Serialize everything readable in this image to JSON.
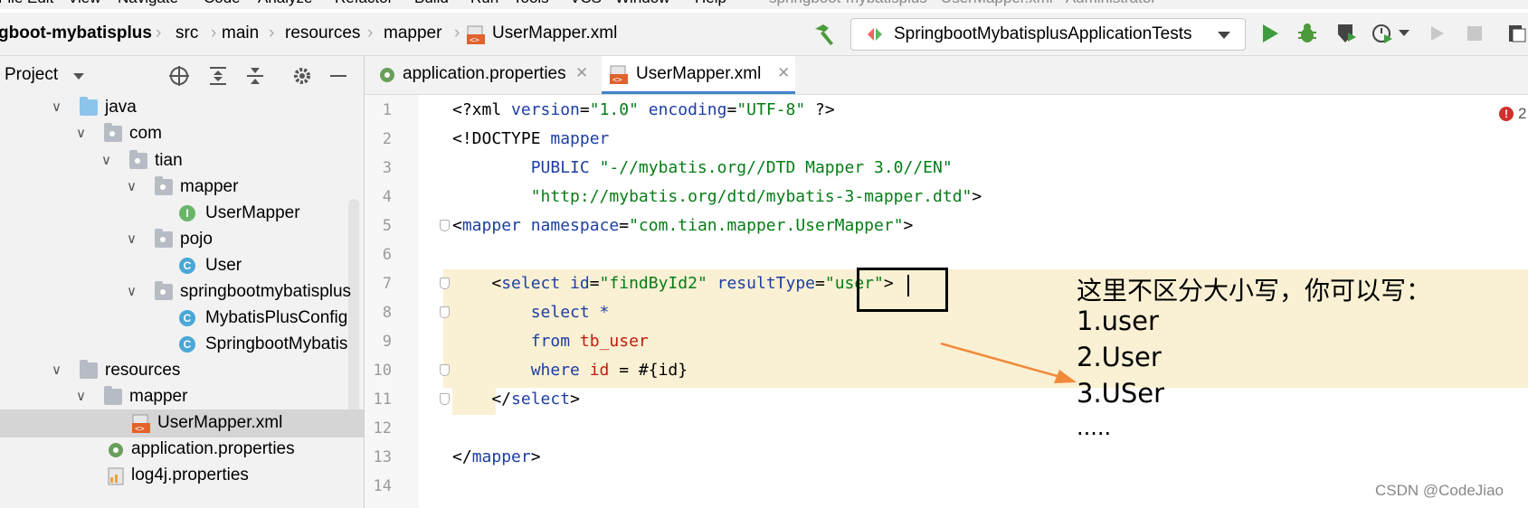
{
  "menubar": {
    "items": [
      "File",
      "Edit",
      "View",
      "Navigate",
      "Code",
      "Analyze",
      "Refactor",
      "Build",
      "Run",
      "Tools",
      "VCS",
      "Window",
      "Help"
    ],
    "window_title": "springboot-mybatisplus - UserMapper.xml - Administrator"
  },
  "breadcrumb": [
    "gboot-mybatisplus",
    "src",
    "main",
    "resources",
    "mapper",
    "UserMapper.xml"
  ],
  "run_config": {
    "label": "SpringbootMybatisplusApplicationTests"
  },
  "project_panel": {
    "title": "Project",
    "tree": [
      {
        "label": "java",
        "depth": 0,
        "expanded": true,
        "icon": "source-folder-icon"
      },
      {
        "label": "com",
        "depth": 1,
        "expanded": true,
        "icon": "package-icon"
      },
      {
        "label": "tian",
        "depth": 2,
        "expanded": true,
        "icon": "package-icon"
      },
      {
        "label": "mapper",
        "depth": 3,
        "expanded": true,
        "icon": "package-icon"
      },
      {
        "label": "UserMapper",
        "depth": 4,
        "icon": "interface-icon"
      },
      {
        "label": "pojo",
        "depth": 3,
        "expanded": true,
        "icon": "package-icon"
      },
      {
        "label": "User",
        "depth": 4,
        "icon": "class-icon"
      },
      {
        "label": "springbootmybatisplus",
        "depth": 3,
        "expanded": true,
        "icon": "package-icon"
      },
      {
        "label": "MybatisPlusConfig",
        "depth": 4,
        "icon": "class-icon"
      },
      {
        "label": "SpringbootMybatis",
        "depth": 4,
        "icon": "spring-class-icon"
      },
      {
        "label": "resources",
        "depth": 0,
        "expanded": true,
        "icon": "resources-folder-icon"
      },
      {
        "label": "mapper",
        "depth": 1,
        "expanded": true,
        "icon": "folder-icon"
      },
      {
        "label": "UserMapper.xml",
        "depth": 2,
        "icon": "xml-file-icon",
        "selected": true
      },
      {
        "label": "application.properties",
        "depth": 1,
        "icon": "properties-file-icon"
      },
      {
        "label": "log4j.properties",
        "depth": 1,
        "icon": "properties-file-icon"
      }
    ]
  },
  "tabs": [
    {
      "label": "application.properties",
      "active": false
    },
    {
      "label": "UserMapper.xml",
      "active": true
    }
  ],
  "editor": {
    "line_numbers": [
      "1",
      "2",
      "3",
      "4",
      "5",
      "6",
      "7",
      "8",
      "9",
      "10",
      "11",
      "12",
      "13",
      "14"
    ],
    "l1": {
      "a": "<?xml ",
      "b": "version",
      "c": "=",
      "d": "\"1.0\"",
      "e": " encoding",
      "f": "=",
      "g": "\"UTF-8\"",
      "h": " ?>"
    },
    "l2": {
      "a": "<!DOCTYPE ",
      "b": "mapper"
    },
    "l3": {
      "a": "        PUBLIC ",
      "b": "\"-//mybatis.org//DTD Mapper 3.0//EN\""
    },
    "l4": {
      "a": "        ",
      "b": "\"http://mybatis.org/dtd/mybatis-3-mapper.dtd\"",
      "c": ">"
    },
    "l5": {
      "a": "<",
      "b": "mapper",
      "c": " namespace",
      "d": "=",
      "e": "\"com.tian.mapper.UserMapper\"",
      "f": ">"
    },
    "l7": {
      "a": "    <",
      "b": "select",
      "c": " id",
      "d": "=",
      "e": "\"findById2\"",
      "f": " resultType",
      "g": "=",
      "h": "\"user\"",
      "i": ">"
    },
    "l8": {
      "a": "        select *"
    },
    "l9": {
      "a": "        from ",
      "b": "tb_user"
    },
    "l10": {
      "a": "        where ",
      "b": "id",
      "c": " = #{id}"
    },
    "l11": {
      "a": "    </",
      "b": "select",
      "c": ">"
    },
    "l13": {
      "a": "</",
      "b": "mapper",
      "c": ">"
    }
  },
  "annotation": {
    "heading": "这里不区分大小写，你可以写：",
    "items": [
      "1.user",
      "2.User",
      "3.USer",
      "....."
    ]
  },
  "error_count": "2",
  "watermark": "CSDN @CodeJiao",
  "colors": {
    "accent": "#4083c9",
    "highlight": "#faf0d3",
    "arrow": "#f08a3a",
    "string": "#067d17",
    "keyword": "#1d3fa3",
    "table": "#c21b0d"
  }
}
